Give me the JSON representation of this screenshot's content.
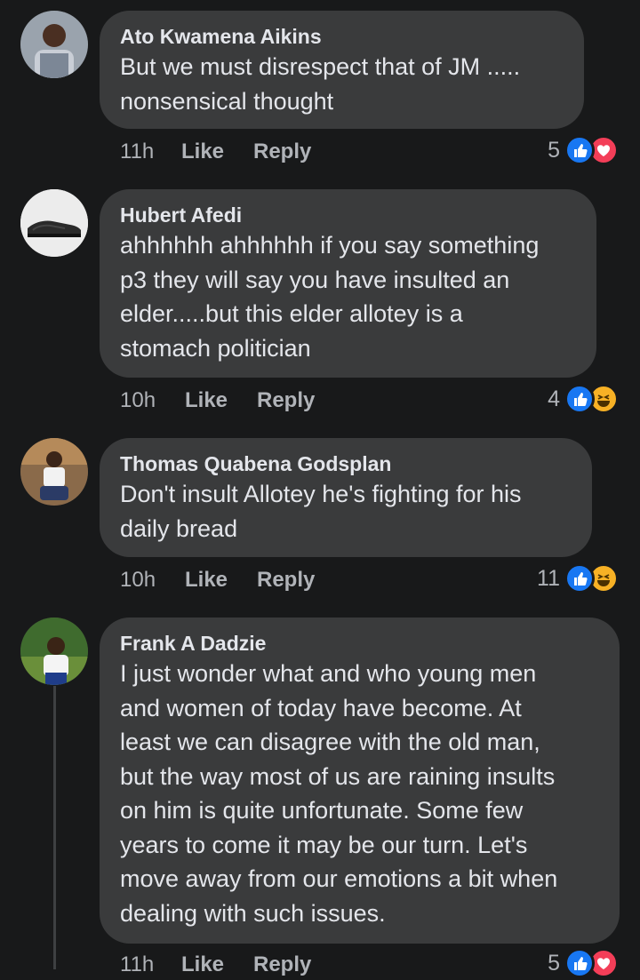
{
  "comments": [
    {
      "author": "Ato Kwamena Aikins",
      "text": "But we must disrespect that of JM .....\nnonsensical thought",
      "time": "11h",
      "like_label": "Like",
      "reply_label": "Reply",
      "reaction_count": "5",
      "reactions": [
        "like-icon",
        "love-icon"
      ]
    },
    {
      "author": "Hubert Afedi",
      "text": "ahhhhhh ahhhhhh if you say something\np3 they will say you have insulted an\nelder.....but this elder allotey is a\nstomach politician",
      "time": "10h",
      "like_label": "Like",
      "reply_label": "Reply",
      "reaction_count": "4",
      "reactions": [
        "like-icon",
        "haha-icon"
      ]
    },
    {
      "author": "Thomas Quabena Godsplan",
      "text": "Don't insult Allotey he's fighting for his\ndaily bread",
      "time": "10h",
      "like_label": "Like",
      "reply_label": "Reply",
      "reaction_count": "11",
      "reactions": [
        "like-icon",
        "haha-icon"
      ]
    },
    {
      "author": "Frank A Dadzie",
      "text": "I just wonder what and who young men\nand women of today have become. At\nleast we can disagree with the old man,\nbut the way most of us are raining insults\non him is quite unfortunate. Some few\nyears to come it may be our turn. Let's\nmove away from our emotions a bit when\ndealing with such issues.",
      "time": "11h",
      "like_label": "Like",
      "reply_label": "Reply",
      "reaction_count": "5",
      "reactions": [
        "like-icon",
        "love-icon"
      ]
    }
  ],
  "colors": {
    "background": "#18191a",
    "bubble": "#3a3b3c",
    "like_blue": "#1877f2",
    "love_red": "#f33e58",
    "haha_yellow": "#f7b125"
  }
}
